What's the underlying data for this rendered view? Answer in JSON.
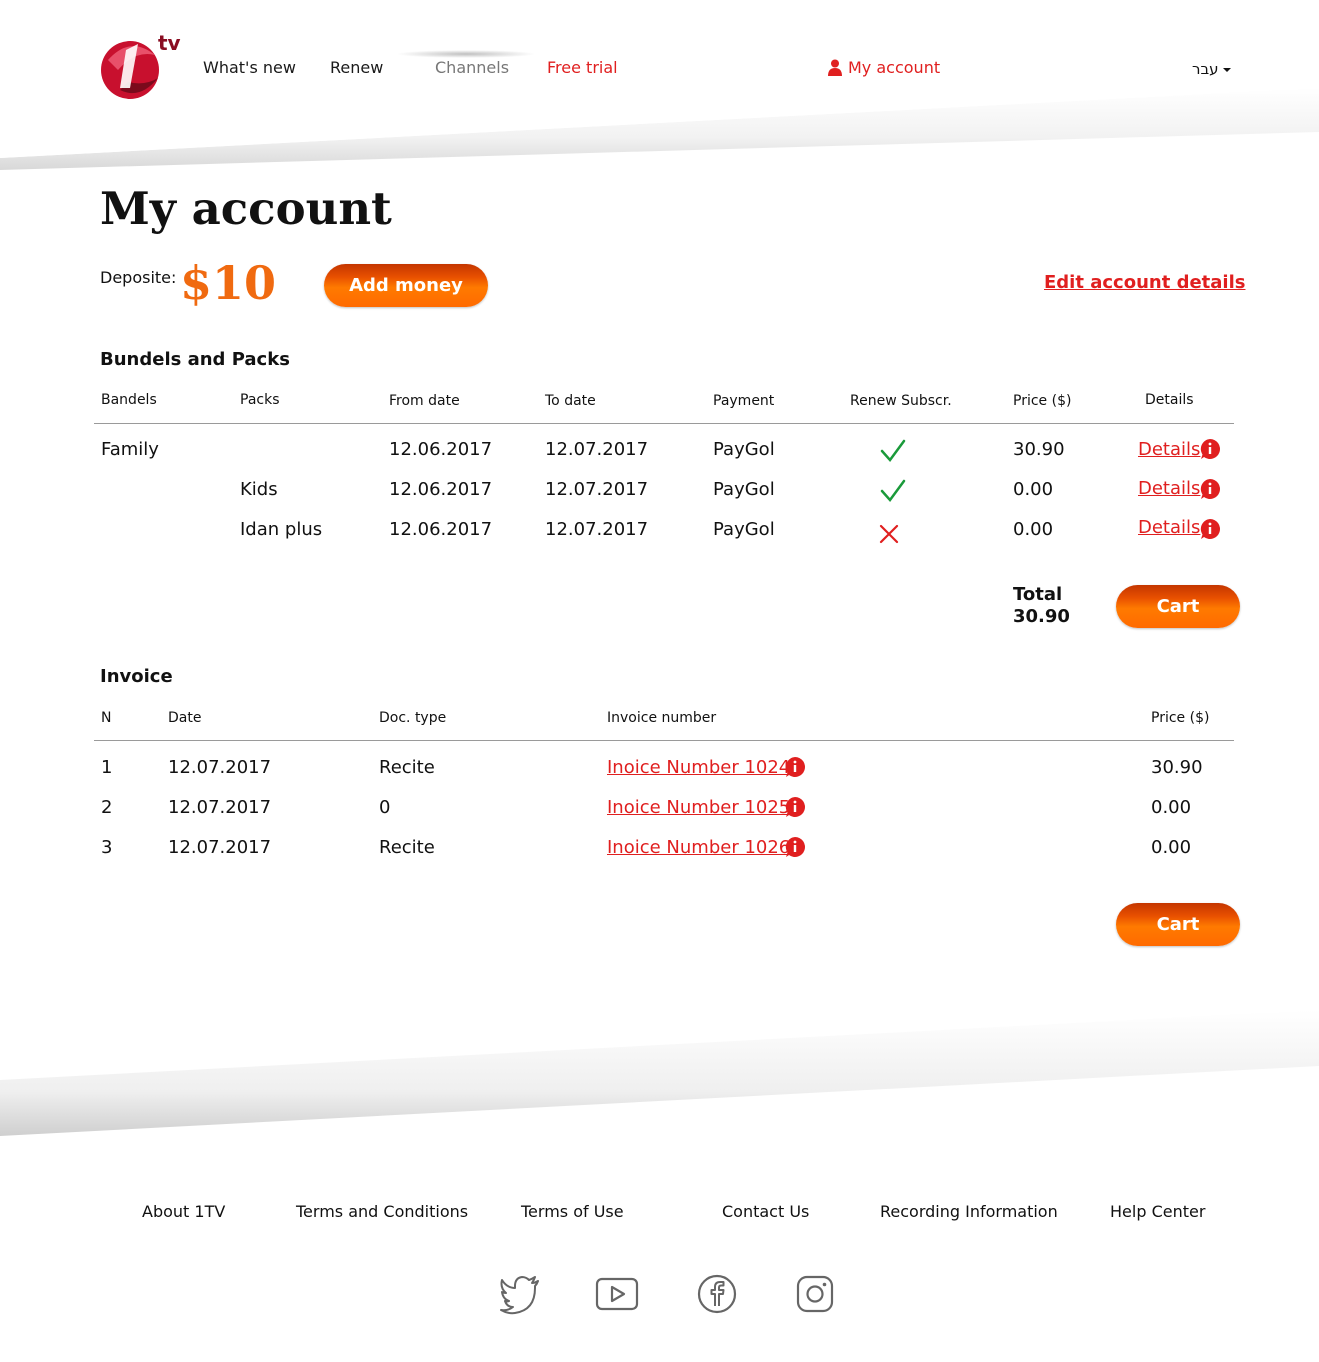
{
  "header": {
    "logo_text": "tv",
    "nav": [
      {
        "label": "What's new"
      },
      {
        "label": "Renew"
      },
      {
        "label": "Channels"
      },
      {
        "label": "Free trial"
      }
    ],
    "account_label": "My account",
    "language_label": "עבר"
  },
  "page": {
    "title": "My account",
    "deposit_label": "Deposite:",
    "deposit_amount": "$10",
    "add_money_label": "Add money",
    "edit_account_label": "Edit account details"
  },
  "bundles": {
    "title": "Bundels and Packs",
    "columns": [
      "Bandels",
      "Packs",
      "From date",
      "To date",
      "Payment",
      "Renew Subscr.",
      "Price ($)",
      "Details"
    ],
    "rows": [
      {
        "bundle": "Family",
        "pack": "",
        "from": "12.06.2017",
        "to": "12.07.2017",
        "payment": "PayGol",
        "renew": true,
        "price": "30.90",
        "details": "Details"
      },
      {
        "bundle": "",
        "pack": "Kids",
        "from": "12.06.2017",
        "to": "12.07.2017",
        "payment": "PayGol",
        "renew": true,
        "price": "0.00",
        "details": "Details"
      },
      {
        "bundle": "",
        "pack": "Idan plus",
        "from": "12.06.2017",
        "to": "12.07.2017",
        "payment": "PayGol",
        "renew": false,
        "price": "0.00",
        "details": "Details"
      }
    ],
    "total_label": "Total",
    "total_value": "30.90",
    "cart_label": "Cart"
  },
  "invoice": {
    "title": "Invoice",
    "columns": [
      "N",
      "Date",
      "Doc. type",
      "Invoice number",
      "Price ($)"
    ],
    "rows": [
      {
        "n": "1",
        "date": "12.07.2017",
        "doc": "Recite",
        "number": "Inoice Number 1024",
        "price": "30.90"
      },
      {
        "n": "2",
        "date": "12.07.2017",
        "doc": "0",
        "number": "Inoice Number 1025",
        "price": "0.00"
      },
      {
        "n": "3",
        "date": "12.07.2017",
        "doc": "Recite",
        "number": "Inoice Number 1026",
        "price": "0.00"
      }
    ],
    "cart_label": "Cart"
  },
  "footer": {
    "links": [
      "About 1TV",
      "Terms and Conditions",
      "Terms of Use",
      "Contact Us",
      "Recording Information",
      "Help Center"
    ],
    "social": [
      "twitter-icon",
      "youtube-icon",
      "facebook-icon",
      "instagram-icon"
    ]
  },
  "colors": {
    "accent_red": "#e01f1f",
    "accent_orange": "#f06a10",
    "check_green": "#1a9a3a"
  }
}
